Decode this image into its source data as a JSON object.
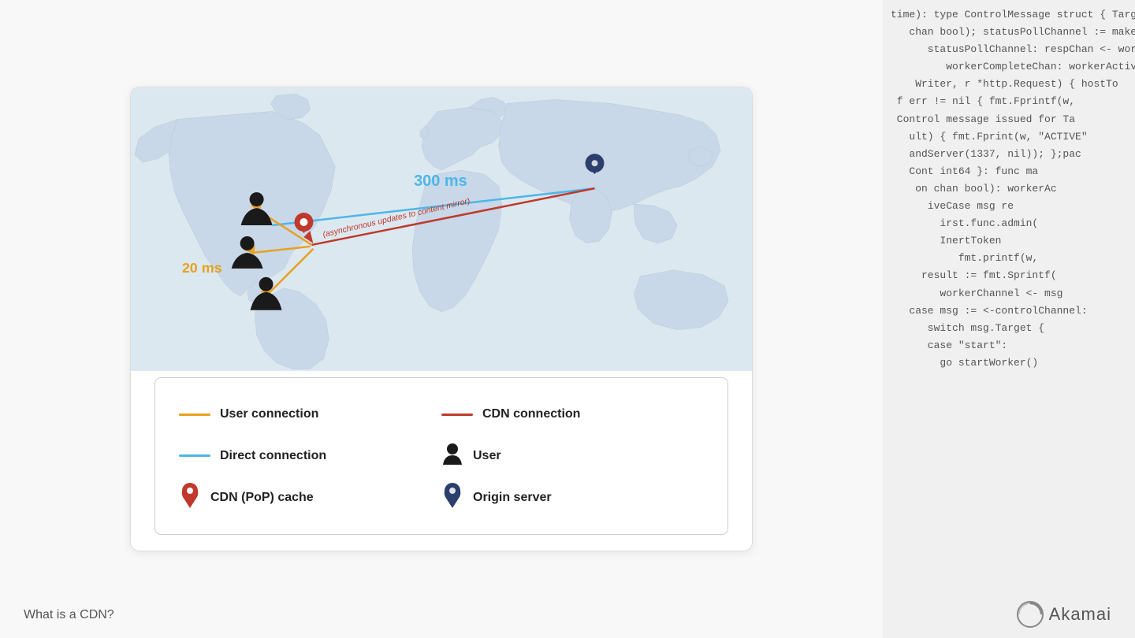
{
  "page": {
    "title": "What is a CDN?"
  },
  "code_lines": [
    "time): type ControlMessage struct { Target string; Co",
    "   chan bool); statusPollChannel := make(chan chan bool); v",
    "      statusPollChannel: respChan <- workerActive; case",
    "         workerCompleteChan: workerActive = status;",
    "    Writer, r *http.Request) { hostTo",
    " f err != nil { fmt.Fprintf(w,",
    " Control message issued for Ta",
    "   ult) { fmt.Fprint(w, \"ACTIVE\"",
    "   andServer(1337, nil)); };pac",
    "   Cont int64 }: func ma",
    "    on chan bool): workerAc",
    "      iveCase msg re",
    "        irst.func.admin(",
    "        InertToken",
    "           fmt.printf(w,"
  ],
  "diagram": {
    "latency_direct": "300 ms",
    "latency_cdn": "20 ms",
    "async_label": "(asynchronous updates to content mirror)"
  },
  "legend": {
    "items_left": [
      {
        "id": "user-connection",
        "label": "User connection",
        "color": "#e8a020",
        "type": "line"
      },
      {
        "id": "cdn-connection",
        "label": "CDN connection",
        "color": "#c0392b",
        "type": "line"
      },
      {
        "id": "direct-connection",
        "label": "Direct connection",
        "color": "#4db6e8",
        "type": "line"
      }
    ],
    "items_right": [
      {
        "id": "user-icon",
        "label": "User",
        "type": "icon"
      },
      {
        "id": "cdn-cache-icon",
        "label": "CDN (PoP) cache",
        "type": "icon"
      },
      {
        "id": "origin-server-icon",
        "label": "Origin server",
        "type": "icon"
      }
    ]
  },
  "logo": {
    "text": "Akamai"
  }
}
